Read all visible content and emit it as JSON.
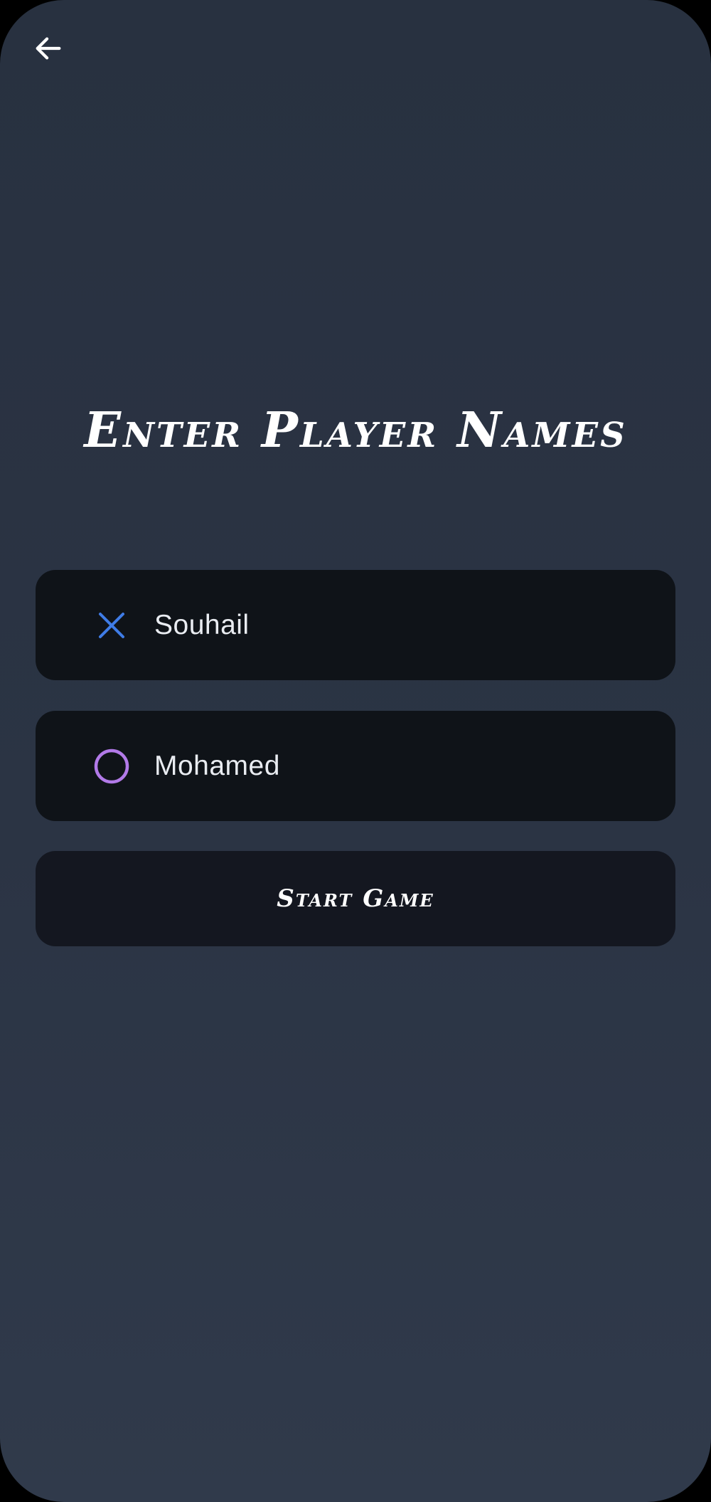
{
  "header": {
    "back_icon": "arrow-left-icon"
  },
  "title": "Enter Player Names",
  "players": [
    {
      "value": "Souhail",
      "icon": "x-mark-icon",
      "color": "#3f7ce6"
    },
    {
      "value": "Mohamed",
      "icon": "circle-o-icon",
      "color": "#b27ae8"
    }
  ],
  "start_button": {
    "label": "Start Game"
  },
  "colors": {
    "background": "#2b3444",
    "field_background": "#0f1318",
    "button_background": "#141720",
    "text": "#ffffff"
  }
}
